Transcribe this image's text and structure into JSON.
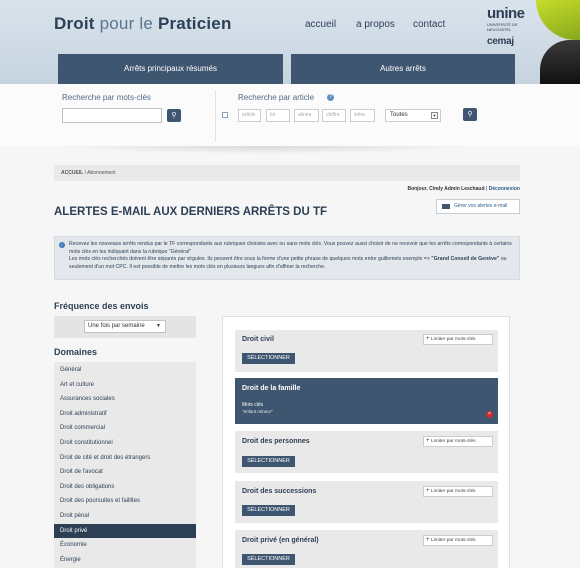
{
  "header": {
    "logo_droit": "Droit",
    "logo_pour_le": "pour le",
    "logo_praticien": "Praticien",
    "nav": [
      "accueil",
      "a propos",
      "contact"
    ],
    "unine": "unine",
    "unine_sub": "UNIVERSITÉ DE NEUCHÂTEL",
    "cemaj": "cemaj"
  },
  "tabs": [
    "Arrêts principaux résumés",
    "Autres arrêts"
  ],
  "search": {
    "keywords_label": "Recherche par mots-clés",
    "article_label": "Recherche par article",
    "article_fields": [
      "article",
      "loi",
      "alinéa",
      "chiffre",
      "lettre"
    ],
    "law_select": "Toutes"
  },
  "breadcrumb": {
    "home": "ACCUEIL",
    "sep": "/",
    "current": "Abonnement"
  },
  "user": {
    "greeting": "Bonjour, Cindy Admin Leschaud",
    "sep": "|",
    "logout": "Déconnexion"
  },
  "page_title": "ALERTES E-MAIL AUX DERNIERS ARRÊTS DU TF",
  "manage_button": "Gérer vos alertes e-mail",
  "info": {
    "line1": "Recevez les nouveaux arrêts rendus par le TF correspondants aux rubriques choisies avec ou sans mots clés. Vous pouvez aussi choisir de ne recevoir que les arrêts correspondants à certains mots clés en les indiquant dans la rubrique \"Général\"",
    "line2_prefix": "Les mots clés recherchés doivent être séparés par virgules. Ils peuvent être sous la forme d'une petite phrase de quelques mots entre guillemets exemple => ",
    "line2_bold": "\"Grand Conseil de Genève\"",
    "line2_suffix": " ou seulement d'un mot CPC. Il est possible de mettre les mots clés en plusieurs langues afin d'affiner la recherche."
  },
  "frequency": {
    "title": "Fréquence des envois",
    "value": "Une fois par semaine"
  },
  "domains": {
    "title": "Domaines",
    "items": [
      "Général",
      "Art et culture",
      "Assurances sociales",
      "Droit administratif",
      "Droit commercial",
      "Droit constitutionnel",
      "Droit de cité et droit des étrangers",
      "Droit de l'avocat",
      "Droit des obligations",
      "Droit des poursuites et faillites",
      "Droit pénal",
      "Droit privé",
      "Économie",
      "Énergie"
    ],
    "active_index": 11
  },
  "cards": [
    {
      "title": "Droit civil",
      "limit": "Limiter par mots-clés",
      "select": "SÉLECTIONNER",
      "active": false
    },
    {
      "title": "Droit de la famille",
      "kw_label": "Mots clés",
      "kw_value": "\"enfant mineur\"",
      "active": true
    },
    {
      "title": "Droit des personnes",
      "limit": "Limiter par mots-clés",
      "select": "SÉLECTIONNER",
      "active": false
    },
    {
      "title": "Droit des successions",
      "limit": "Limiter par mots-clés",
      "select": "SÉLECTIONNER",
      "active": false
    },
    {
      "title": "Droit privé (en général)",
      "limit": "Limiter par mots-clés",
      "select": "SÉLECTIONNER",
      "active": false
    }
  ],
  "colors": {
    "navy": "#2d3f55",
    "tab_blue": "#3e5670",
    "link": "#2b5c8a",
    "remove_red": "#d32b2b"
  }
}
